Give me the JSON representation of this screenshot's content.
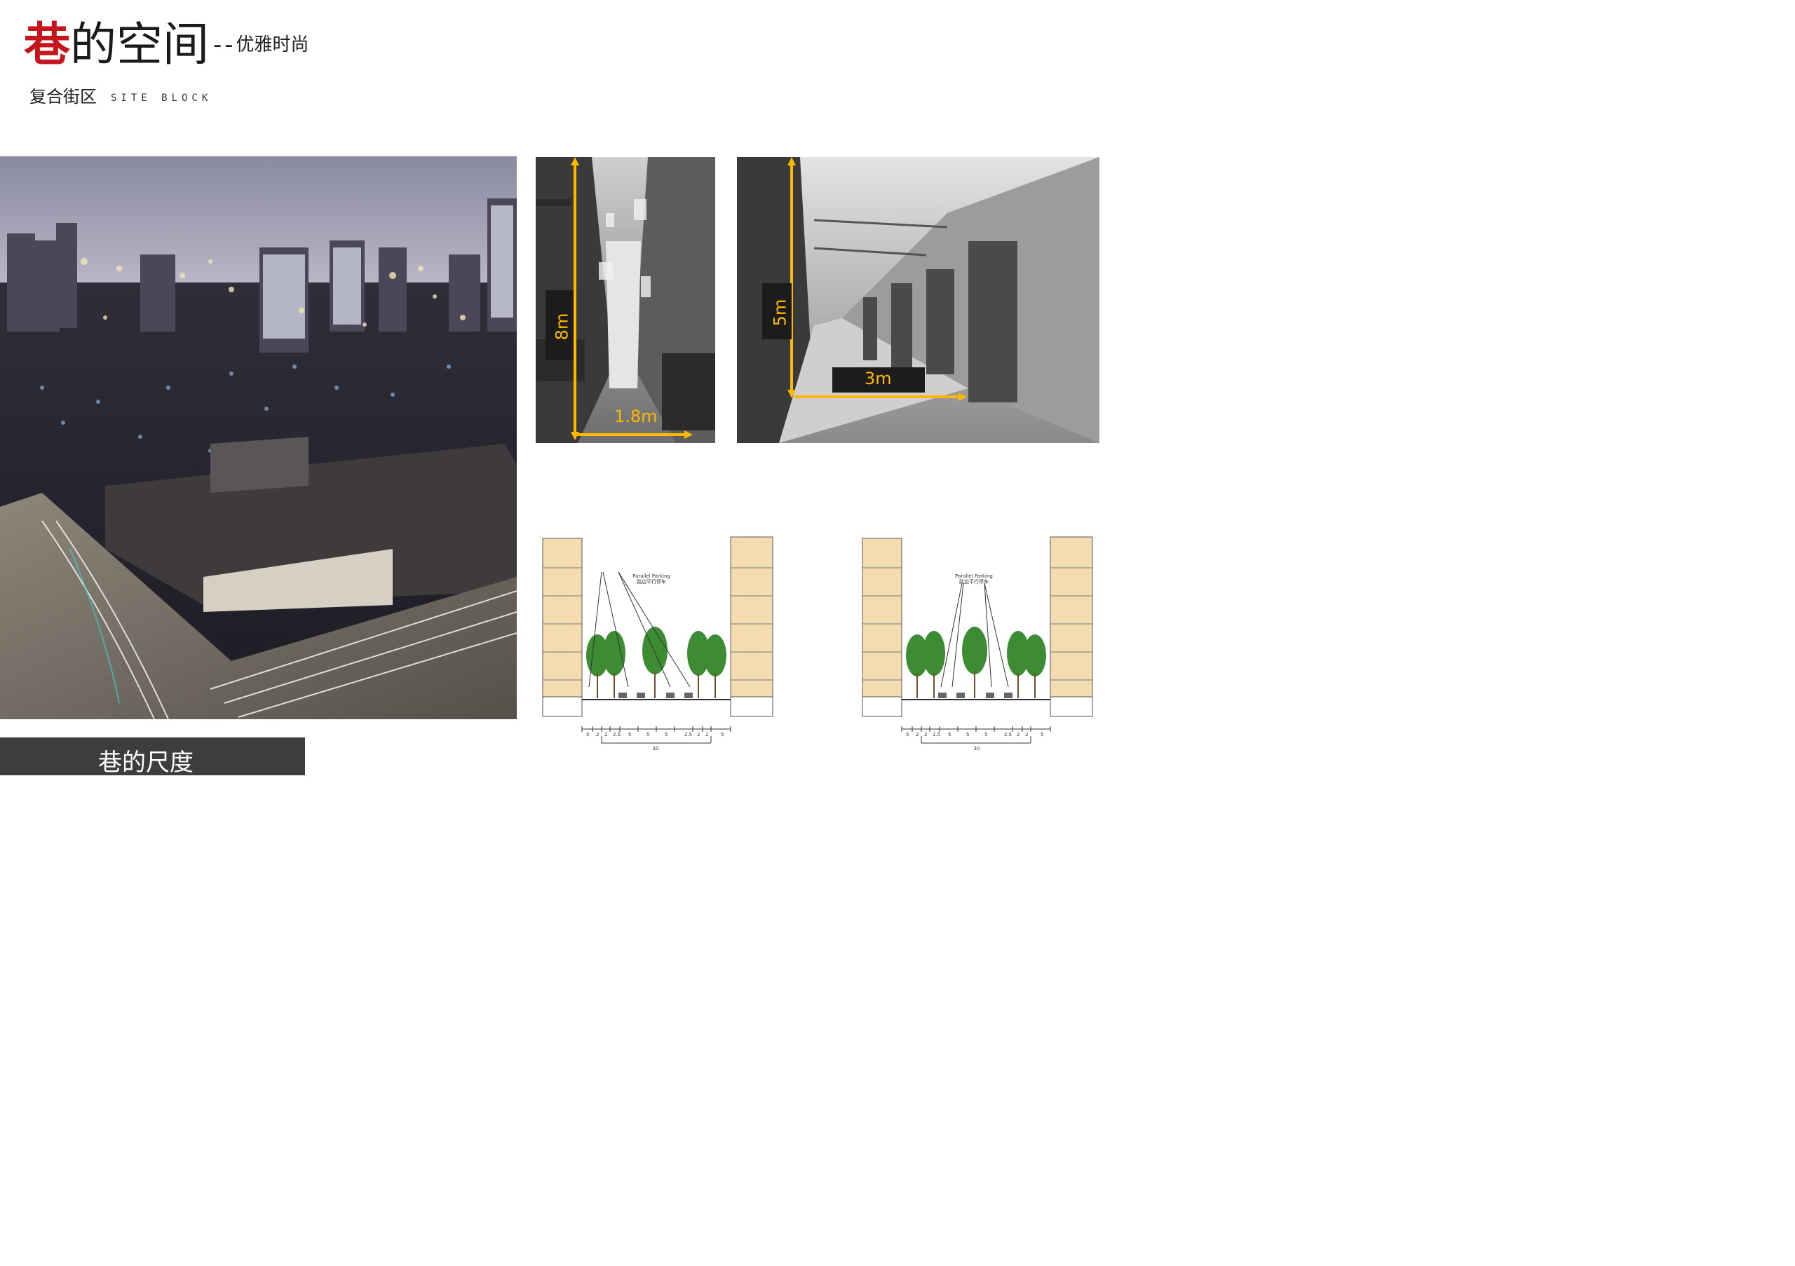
{
  "header": {
    "title_highlight": "巷",
    "title_main": "的空间",
    "title_separator": "--",
    "title_sub": "优雅时尚",
    "subtitle_cn": "复合街区",
    "subtitle_en": "SITE BLOCK"
  },
  "caption": {
    "text": "巷的尺度"
  },
  "alley_photos": [
    {
      "height_label": "8m",
      "width_label": "1.8m"
    },
    {
      "height_label": "5m",
      "width_label": "3m"
    }
  ],
  "sections": [
    {
      "label_en": "Parallel Parking",
      "label_cn": "路边平行停车",
      "dims": [
        "5",
        "2",
        "2",
        "2.5",
        "5",
        "5",
        "5",
        "2.5",
        "2",
        "2",
        "5"
      ],
      "total": "30"
    },
    {
      "label_en": "Parallel Parking",
      "label_cn": "路边平行停车",
      "dims": [
        "5",
        "2",
        "2",
        "2.5",
        "5",
        "5",
        "5",
        "2.5",
        "2",
        "2",
        "5"
      ],
      "total": "30"
    }
  ],
  "colors": {
    "title_red": "#c4161c",
    "dimension_yellow": "#ffb800",
    "caption_bg": "#3d3d3d"
  }
}
